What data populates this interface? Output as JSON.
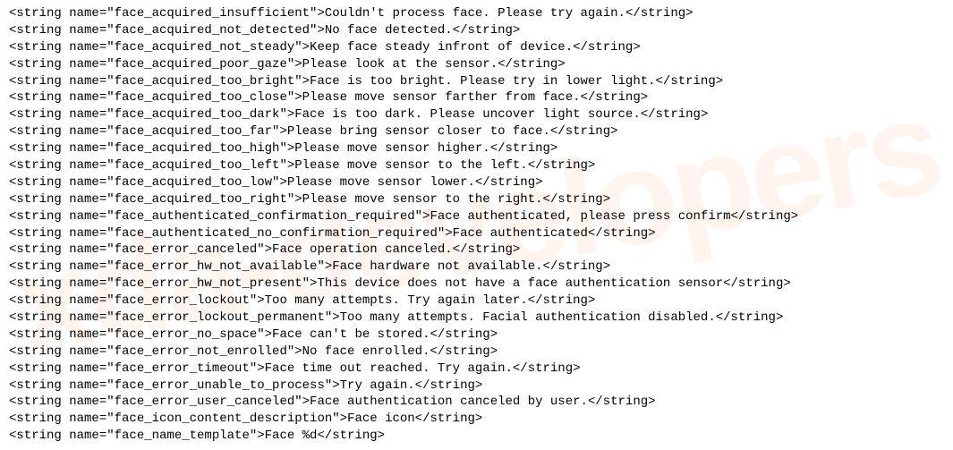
{
  "watermark": "xda-developers",
  "strings": [
    {
      "name": "face_acquired_insufficient",
      "value": "Couldn't process face. Please try again."
    },
    {
      "name": "face_acquired_not_detected",
      "value": "No face detected."
    },
    {
      "name": "face_acquired_not_steady",
      "value": "Keep face steady infront of device."
    },
    {
      "name": "face_acquired_poor_gaze",
      "value": "Please look at the sensor."
    },
    {
      "name": "face_acquired_too_bright",
      "value": "Face is too bright. Please try in lower light."
    },
    {
      "name": "face_acquired_too_close",
      "value": "Please move sensor farther from face."
    },
    {
      "name": "face_acquired_too_dark",
      "value": "Face is too dark. Please uncover light source."
    },
    {
      "name": "face_acquired_too_far",
      "value": "Please bring sensor closer to face."
    },
    {
      "name": "face_acquired_too_high",
      "value": "Please move sensor higher."
    },
    {
      "name": "face_acquired_too_left",
      "value": "Please move sensor to the left."
    },
    {
      "name": "face_acquired_too_low",
      "value": "Please move sensor lower."
    },
    {
      "name": "face_acquired_too_right",
      "value": "Please move sensor to the right."
    },
    {
      "name": "face_authenticated_confirmation_required",
      "value": "Face authenticated, please press confirm"
    },
    {
      "name": "face_authenticated_no_confirmation_required",
      "value": "Face authenticated"
    },
    {
      "name": "face_error_canceled",
      "value": "Face operation canceled."
    },
    {
      "name": "face_error_hw_not_available",
      "value": "Face hardware not available."
    },
    {
      "name": "face_error_hw_not_present",
      "value": "This device does not have a face authentication sensor"
    },
    {
      "name": "face_error_lockout",
      "value": "Too many attempts. Try again later."
    },
    {
      "name": "face_error_lockout_permanent",
      "value": "Too many attempts. Facial authentication disabled."
    },
    {
      "name": "face_error_no_space",
      "value": "Face can't be stored."
    },
    {
      "name": "face_error_not_enrolled",
      "value": "No face enrolled."
    },
    {
      "name": "face_error_timeout",
      "value": "Face time out reached. Try again."
    },
    {
      "name": "face_error_unable_to_process",
      "value": "Try again."
    },
    {
      "name": "face_error_user_canceled",
      "value": "Face authentication canceled by user."
    },
    {
      "name": "face_icon_content_description",
      "value": "Face icon"
    },
    {
      "name": "face_name_template",
      "value": "Face %d"
    }
  ]
}
